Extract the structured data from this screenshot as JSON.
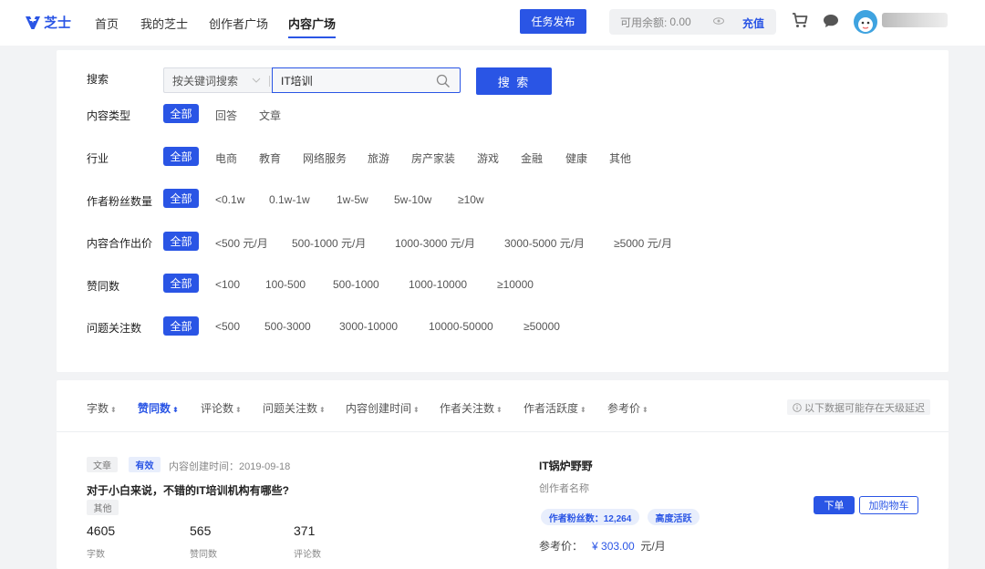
{
  "brand": {
    "name": "芝士",
    "color": "#2a55e5"
  },
  "nav": {
    "items": [
      "首页",
      "我的芝士",
      "创作者广场",
      "内容广场"
    ],
    "active_index": 3,
    "publish_label": "任务发布",
    "balance_label": "可用余额:",
    "balance_value": "0.00",
    "recharge_label": "充值",
    "icons": [
      "cart-icon",
      "chat-icon"
    ]
  },
  "search": {
    "label": "搜索",
    "mode": "按关键词搜索",
    "query": "IT培训",
    "button": "搜 索"
  },
  "filters": {
    "content_type": {
      "label": "内容类型",
      "options": [
        "全部",
        "回答",
        "文章"
      ],
      "selected": 0
    },
    "industry": {
      "label": "行业",
      "options": [
        "全部",
        "电商",
        "教育",
        "网络服务",
        "旅游",
        "房产家装",
        "游戏",
        "金融",
        "健康",
        "其他"
      ],
      "selected": 0
    },
    "fans": {
      "label": "作者粉丝数量",
      "options": [
        "全部",
        "<0.1w",
        "0.1w-1w",
        "1w-5w",
        "5w-10w",
        "≥10w"
      ],
      "selected": 0
    },
    "price": {
      "label": "内容合作出价",
      "options": [
        "全部",
        "<500 元/月",
        "500-1000 元/月",
        "1000-3000 元/月",
        "3000-5000 元/月",
        "≥5000 元/月"
      ],
      "selected": 0
    },
    "likes": {
      "label": "赞同数",
      "options": [
        "全部",
        "<100",
        "100-500",
        "500-1000",
        "1000-10000",
        "≥10000"
      ],
      "selected": 0
    },
    "followers": {
      "label": "问题关注数",
      "options": [
        "全部",
        "<500",
        "500-3000",
        "3000-10000",
        "10000-50000",
        "≥50000"
      ],
      "selected": 0
    }
  },
  "sort": {
    "items": [
      "字数",
      "赞同数",
      "评论数",
      "问题关注数",
      "内容创建时间",
      "作者关注数",
      "作者活跃度",
      "参考价"
    ],
    "active_index": 1,
    "arrow": "⬍",
    "delay_note": "以下数据可能存在天级延迟"
  },
  "result": {
    "type_tag": "文章",
    "status_tag": "有效",
    "created_label": "内容创建时间：",
    "created_date": "2019-09-18",
    "title": "对于小白来说，不错的IT培训机构有哪些?",
    "category_tag": "其他",
    "stats": [
      {
        "value": "4605",
        "label": "字数"
      },
      {
        "value": "565",
        "label": "赞同数"
      },
      {
        "value": "371",
        "label": "评论数"
      }
    ],
    "author_name": "IT锅炉野野",
    "author_sub": "创作者名称",
    "fans_pill": "作者粉丝数：12,264",
    "active_pill": "高度活跃",
    "price_label": "参考价：",
    "price_value": "¥ 303.00",
    "price_unit": "元/月",
    "order_button": "下单",
    "cart_button": "加购物车"
  }
}
